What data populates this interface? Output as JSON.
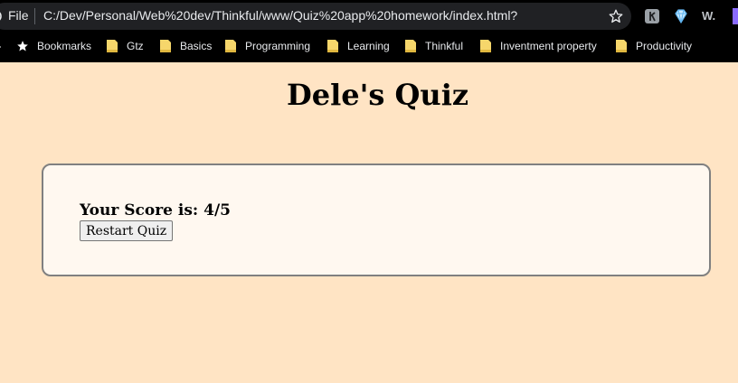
{
  "browser": {
    "file_label": "File",
    "url": "C:/Dev/Personal/Web%20dev/Thinkful/www/Quiz%20app%20homework/index.html?",
    "extensions": [
      {
        "icon": "reader-mode-icon"
      },
      {
        "icon": "diamond-extension-icon"
      },
      {
        "icon": "w-extension-icon",
        "text": "W."
      }
    ],
    "bookmarks": [
      {
        "label": "Bookmarks",
        "icon": "star-icon"
      },
      {
        "label": "Gtz",
        "icon": "folder-icon"
      },
      {
        "label": "Basics",
        "icon": "folder-icon"
      },
      {
        "label": "Programming",
        "icon": "folder-icon"
      },
      {
        "label": "Learning",
        "icon": "folder-icon"
      },
      {
        "label": "Thinkful",
        "icon": "folder-icon"
      },
      {
        "label": "Inventment property",
        "icon": "folder-icon"
      },
      {
        "label": "Productivity",
        "icon": "folder-icon"
      }
    ]
  },
  "page": {
    "title": "Dele's Quiz",
    "score_text": "Your Score is: 4/5",
    "restart_label": "Restart Quiz"
  },
  "colors": {
    "page_background": "#FFE4C4",
    "card_background": "#FFF8F0",
    "card_border": "#808080",
    "browser_chrome": "#000000",
    "address_bar": "#202124"
  }
}
